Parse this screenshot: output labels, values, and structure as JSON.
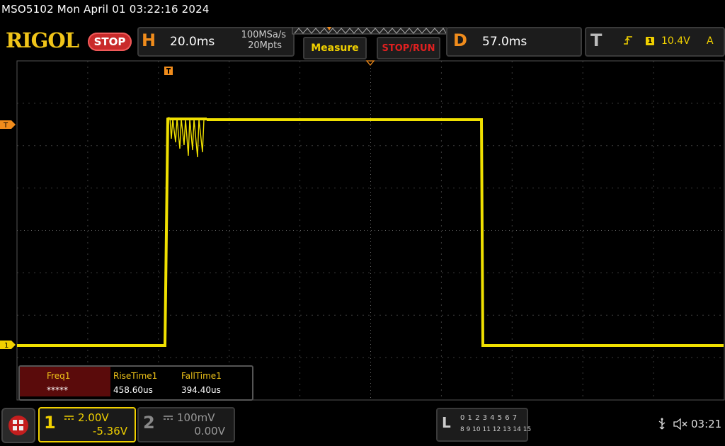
{
  "title": "MSO5102  Mon April 01 03:22:16 2024",
  "logo": "RIGOL",
  "run_state": "STOP",
  "horizontal": {
    "letter": "H",
    "timebase": "20.0ms",
    "sample_rate": "100MSa/s",
    "memory_depth": "20Mpts"
  },
  "buttons": {
    "measure": "Measure",
    "stop_run": "STOP/RUN"
  },
  "delay": {
    "letter": "D",
    "value": "57.0ms"
  },
  "trigger": {
    "letter": "T",
    "slope_icon": "rising-edge-icon",
    "source": "1",
    "level": "10.4V",
    "mode": "A"
  },
  "markers": {
    "trigger_level": "T",
    "ch1_ground": "1"
  },
  "measurements": {
    "headers": [
      "Freq1",
      "RiseTime1",
      "FallTime1"
    ],
    "values": [
      "*****",
      "458.60us",
      "394.40us"
    ]
  },
  "channel1": {
    "number": "1",
    "scale": "2.00V",
    "offset": "-5.36V",
    "color": "#f0d000"
  },
  "channel2": {
    "number": "2",
    "scale": "100mV",
    "offset": "0.00V"
  },
  "logic": {
    "letter": "L",
    "row1": "0 1 2 3  4 5 6 7",
    "row2": "8 9 10 11 12 13 14 15"
  },
  "status": {
    "time": "03:21"
  },
  "colors": {
    "trace": "#f0e000",
    "accent": "#f08c1c",
    "grid": "#555555"
  }
}
